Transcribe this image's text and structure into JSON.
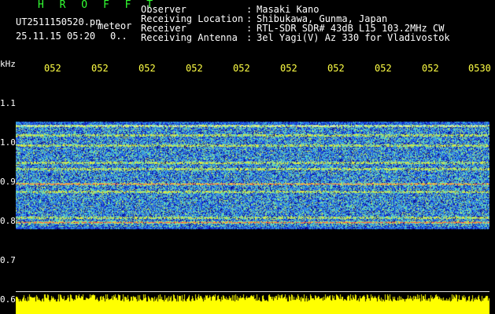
{
  "header": {
    "app_title": "H R O F F T",
    "file_name": "UT2511150520.pn",
    "mode": "meteor",
    "date_time": "25.11.15 05:20",
    "status": "0.."
  },
  "info": {
    "rows": [
      {
        "label": "Observer",
        "value": "Masaki Kano"
      },
      {
        "label": "Receiving Location",
        "value": "Shibukawa, Gunma, Japan"
      },
      {
        "label": "Receiver",
        "value": "RTL-SDR SDR# 43dB L15 103.2MHz CW"
      },
      {
        "label": "Receiving Antenna",
        "value": "3el Yagi(V) Az 330 for Vladivostok"
      }
    ]
  },
  "axis": {
    "unit": "kHz",
    "x_ticks": [
      "052",
      "052",
      "052",
      "052",
      "052",
      "052",
      "052",
      "052",
      "052",
      "0530"
    ],
    "y_ticks": [
      "1.1",
      "1.0",
      "0.9",
      "0.8",
      "0.7",
      "0.6"
    ]
  },
  "colors": {
    "background": "#000000",
    "title": "#33ff33",
    "tick_x": "#ffff44",
    "signal_band": "#1a2fd8",
    "noise_bar": "#ffff00",
    "strong_line": "#ff3344"
  }
}
